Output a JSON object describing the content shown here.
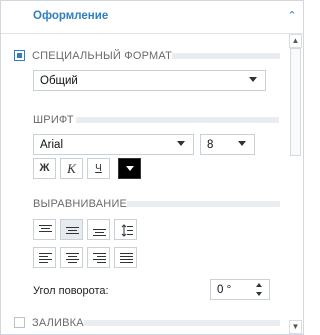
{
  "header": {
    "title": "Оформление"
  },
  "special_format": {
    "label": "СПЕЦИАЛЬНЫЙ ФОРМАТ",
    "checked": true,
    "value": "Общий"
  },
  "font": {
    "label": "ШРИФТ",
    "family": "Arial",
    "size": "8",
    "bold_label": "Ж",
    "italic_label": "К",
    "underline_label": "Ч",
    "color": "#000000"
  },
  "alignment": {
    "label": "ВЫРАВНИВАНИЕ",
    "rotation_label": "Угол поворота:",
    "rotation_value": "0 °"
  },
  "fill": {
    "label": "ЗАЛИВКА",
    "checked": false
  },
  "icons": {
    "collapse": "chevron-up-icon",
    "scroll_up": "triangle-up-icon",
    "scroll_down": "triangle-down-icon"
  }
}
